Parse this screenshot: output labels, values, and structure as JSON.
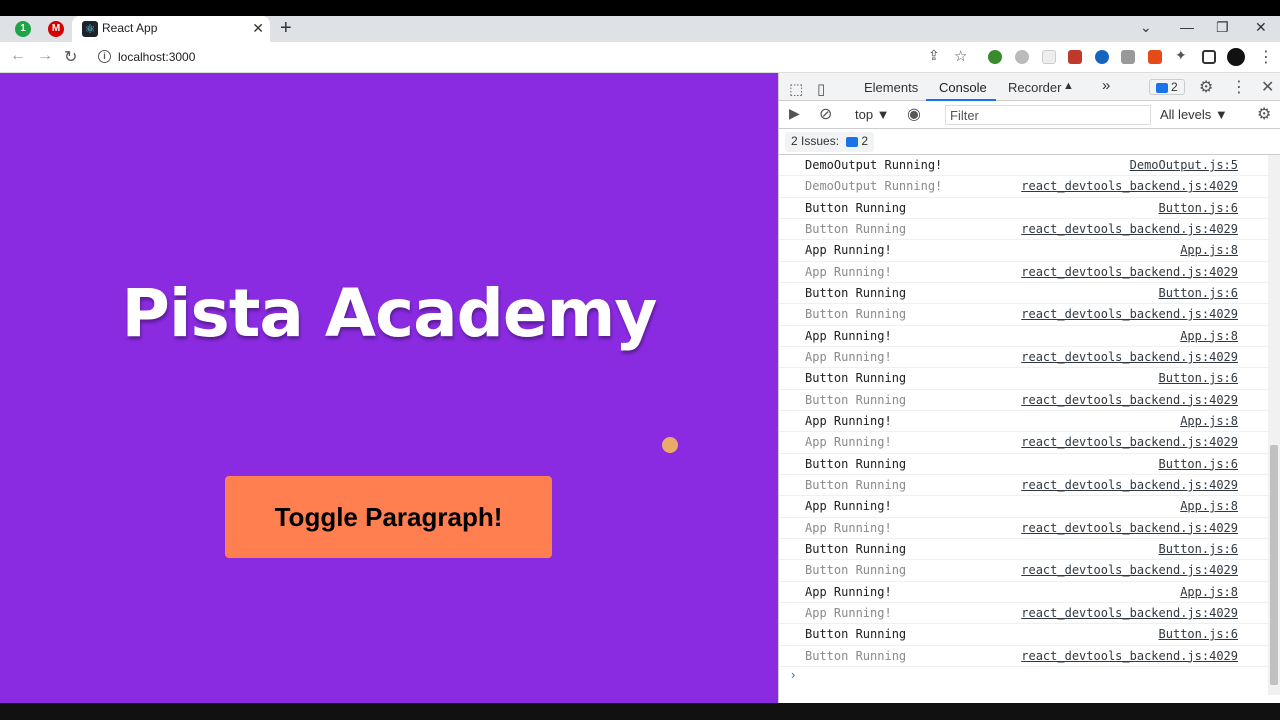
{
  "browser": {
    "tab": {
      "title": "React App"
    },
    "url": "localhost:3000",
    "new_tab_symbol": "+",
    "close_symbol": "✕",
    "pinned": [
      {
        "label": "1",
        "color": "#1ea446"
      },
      {
        "label": "M",
        "color": "#d50000"
      }
    ]
  },
  "page": {
    "heading": "Pista Academy",
    "button_label": "Toggle Paragraph!",
    "background": "#8a2be2",
    "button_color": "#ff7f50"
  },
  "devtools": {
    "tabs": {
      "elements": "Elements",
      "console": "Console",
      "recorder": "Recorder",
      "more": "»"
    },
    "issue_badge_count": "2",
    "context": "top ▼",
    "filter_placeholder": "Filter",
    "levels": "All levels ▼",
    "issues": {
      "label": "2 Issues:",
      "count": "2"
    },
    "logs": [
      {
        "msg": "DemoOutput Running!",
        "src": "DemoOutput.js:5",
        "kind": "primary"
      },
      {
        "msg": "DemoOutput Running!",
        "src": "react_devtools_backend.js:4029",
        "kind": "dim"
      },
      {
        "msg": "Button Running",
        "src": "Button.js:6",
        "kind": "primary"
      },
      {
        "msg": "Button Running",
        "src": "react_devtools_backend.js:4029",
        "kind": "dim"
      },
      {
        "msg": "App Running!",
        "src": "App.js:8",
        "kind": "primary"
      },
      {
        "msg": "App Running!",
        "src": "react_devtools_backend.js:4029",
        "kind": "dim"
      },
      {
        "msg": "Button Running",
        "src": "Button.js:6",
        "kind": "primary"
      },
      {
        "msg": "Button Running",
        "src": "react_devtools_backend.js:4029",
        "kind": "dim"
      },
      {
        "msg": "App Running!",
        "src": "App.js:8",
        "kind": "primary"
      },
      {
        "msg": "App Running!",
        "src": "react_devtools_backend.js:4029",
        "kind": "dim"
      },
      {
        "msg": "Button Running",
        "src": "Button.js:6",
        "kind": "primary"
      },
      {
        "msg": "Button Running",
        "src": "react_devtools_backend.js:4029",
        "kind": "dim"
      },
      {
        "msg": "App Running!",
        "src": "App.js:8",
        "kind": "primary"
      },
      {
        "msg": "App Running!",
        "src": "react_devtools_backend.js:4029",
        "kind": "dim"
      },
      {
        "msg": "Button Running",
        "src": "Button.js:6",
        "kind": "primary"
      },
      {
        "msg": "Button Running",
        "src": "react_devtools_backend.js:4029",
        "kind": "dim"
      },
      {
        "msg": "App Running!",
        "src": "App.js:8",
        "kind": "primary"
      },
      {
        "msg": "App Running!",
        "src": "react_devtools_backend.js:4029",
        "kind": "dim"
      },
      {
        "msg": "Button Running",
        "src": "Button.js:6",
        "kind": "primary"
      },
      {
        "msg": "Button Running",
        "src": "react_devtools_backend.js:4029",
        "kind": "dim"
      },
      {
        "msg": "App Running!",
        "src": "App.js:8",
        "kind": "primary"
      },
      {
        "msg": "App Running!",
        "src": "react_devtools_backend.js:4029",
        "kind": "dim"
      },
      {
        "msg": "Button Running",
        "src": "Button.js:6",
        "kind": "primary"
      },
      {
        "msg": "Button Running",
        "src": "react_devtools_backend.js:4029",
        "kind": "dim"
      }
    ],
    "prompt_symbol": "›"
  }
}
